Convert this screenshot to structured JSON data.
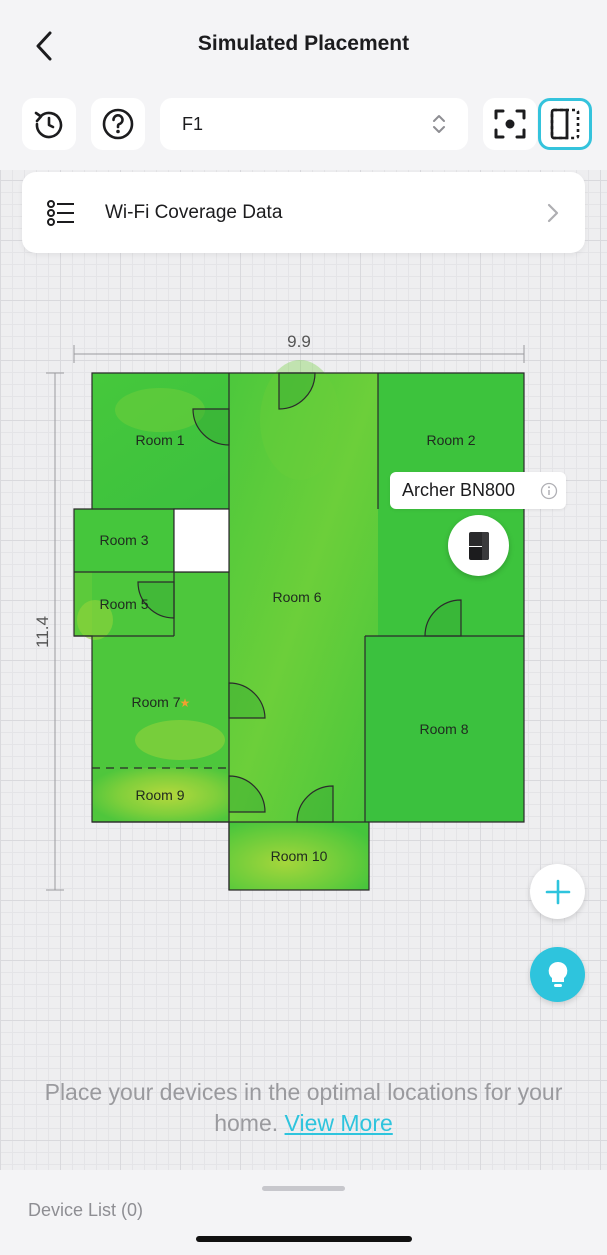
{
  "header": {
    "title": "Simulated Placement",
    "floor_value": "F1"
  },
  "coverage": {
    "label": "Wi-Fi Coverage Data"
  },
  "floorplan": {
    "width_label": "9.9",
    "height_label": "11.4",
    "rooms": [
      {
        "key": "room1",
        "label": "Room 1"
      },
      {
        "key": "room2",
        "label": "Room 2"
      },
      {
        "key": "room3",
        "label": "Room 3"
      },
      {
        "key": "room5",
        "label": "Room 5"
      },
      {
        "key": "room6",
        "label": "Room 6"
      },
      {
        "key": "room7",
        "label": "Room 7"
      },
      {
        "key": "room8",
        "label": "Room 8"
      },
      {
        "key": "room9",
        "label": "Room 9"
      },
      {
        "key": "room10",
        "label": "Room 10"
      }
    ],
    "room7_star": "★",
    "colors": {
      "strong": "#3cc63c",
      "medium": "#5fcf3a",
      "weak": "#b2d93b",
      "wall": "#2b2b2b"
    }
  },
  "device": {
    "name": "Archer BN800",
    "icon": "router-icon"
  },
  "hint": {
    "text": "Place your devices in the optimal locations for your home.",
    "link": "View More"
  },
  "bottom": {
    "device_list": "Device List (0)"
  },
  "accent": "#2ec4dd"
}
